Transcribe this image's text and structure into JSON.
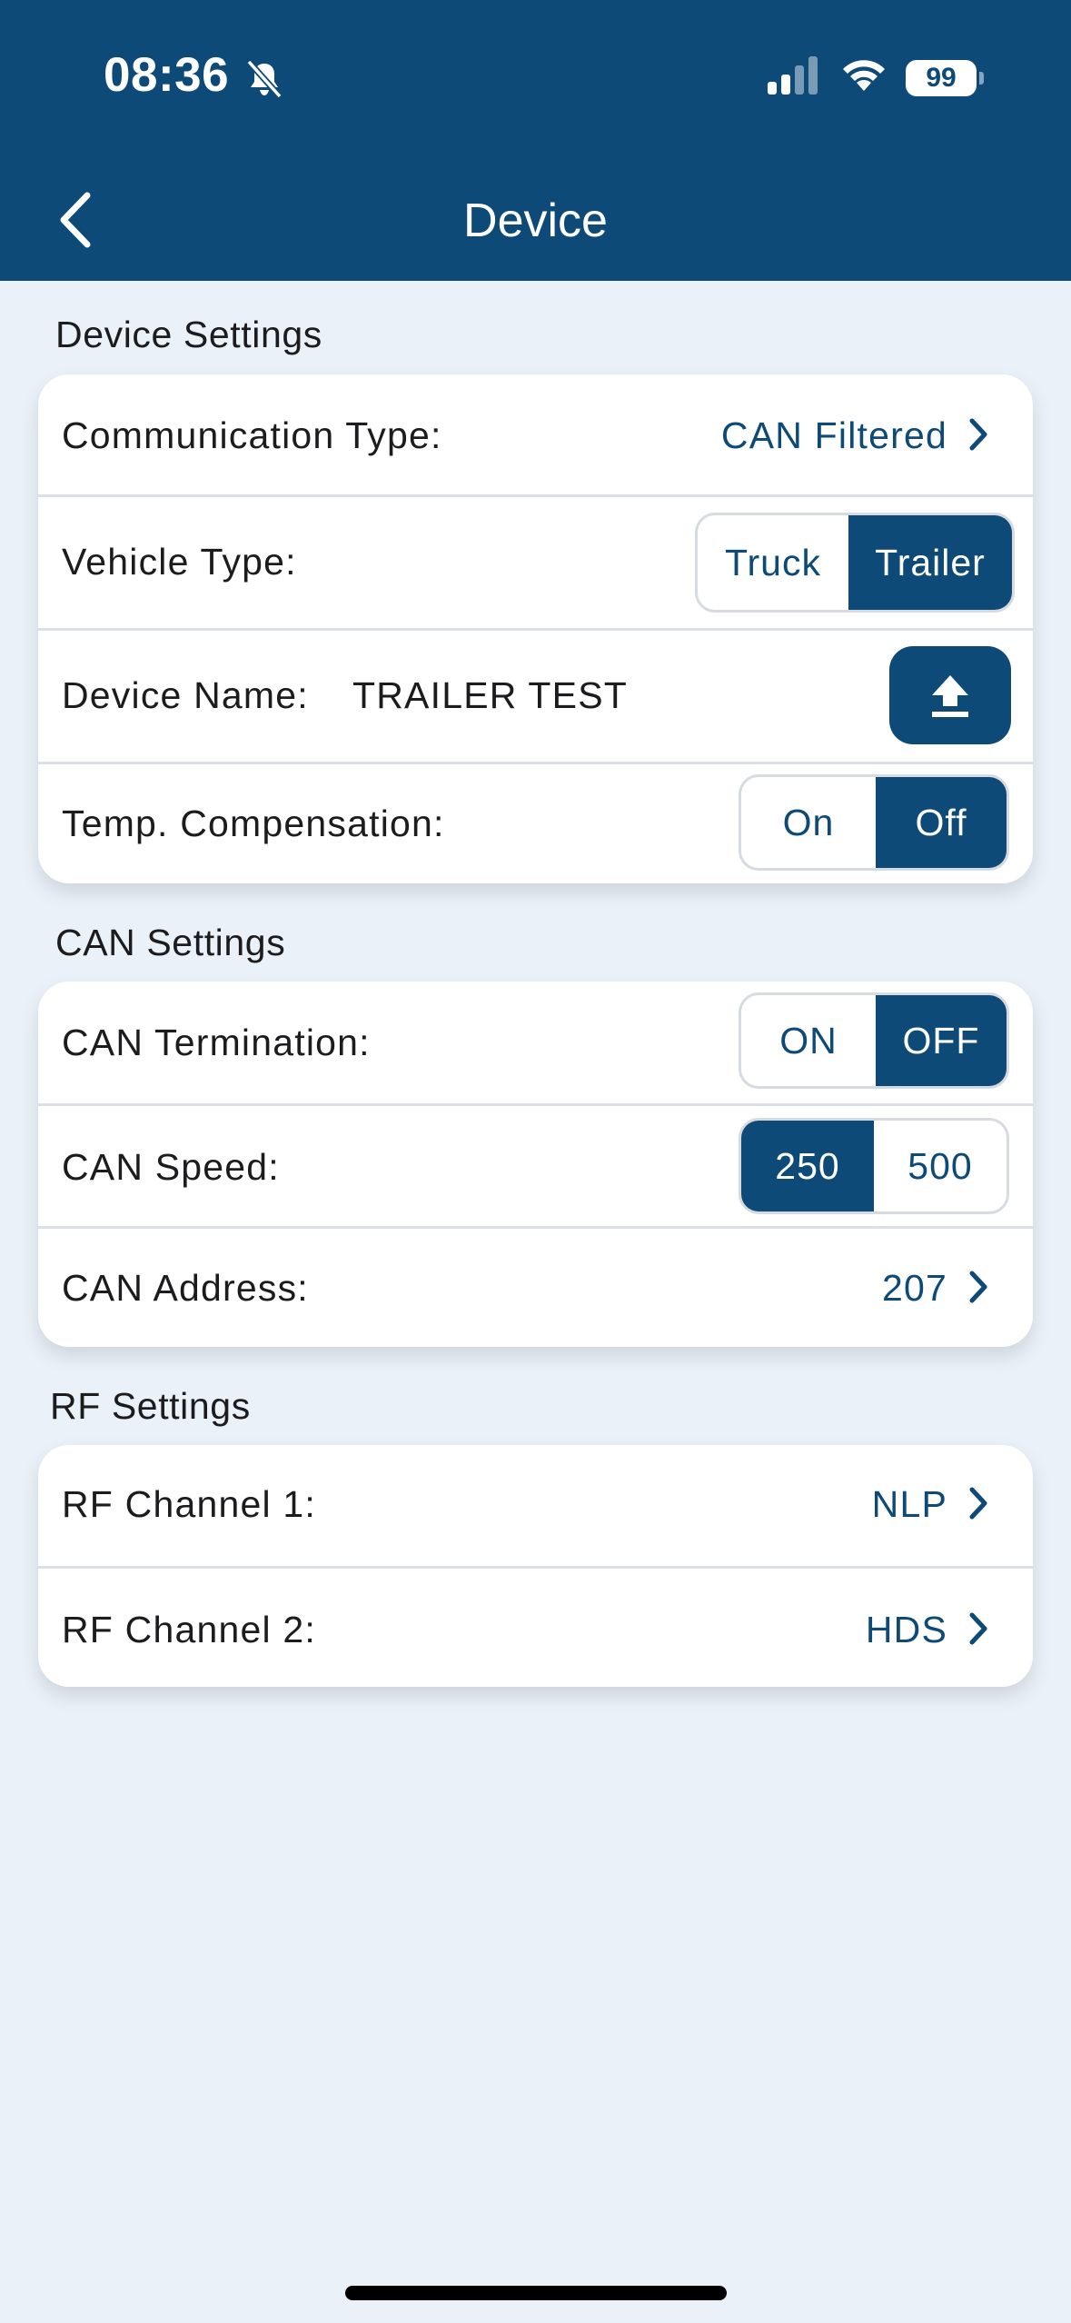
{
  "status_bar": {
    "time": "08:36",
    "battery": "99"
  },
  "nav": {
    "title": "Device"
  },
  "device_settings": {
    "heading": "Device Settings",
    "communication_type": {
      "label": "Communication Type:",
      "value": "CAN Filtered"
    },
    "vehicle_type": {
      "label": "Vehicle Type:",
      "options": [
        "Truck",
        "Trailer"
      ],
      "selected": "Trailer"
    },
    "device_name": {
      "label": "Device Name:",
      "value": "TRAILER TEST"
    },
    "temp_compensation": {
      "label": "Temp. Compensation:",
      "options": [
        "On",
        "Off"
      ],
      "selected": "Off"
    }
  },
  "can_settings": {
    "heading": "CAN Settings",
    "termination": {
      "label": "CAN Termination:",
      "options": [
        "ON",
        "OFF"
      ],
      "selected": "OFF"
    },
    "speed": {
      "label": "CAN Speed:",
      "options": [
        "250",
        "500"
      ],
      "selected": "250"
    },
    "address": {
      "label": "CAN Address:",
      "value": "207"
    }
  },
  "rf_settings": {
    "heading": "RF Settings",
    "channel1": {
      "label": "RF Channel 1:",
      "value": "NLP"
    },
    "channel2": {
      "label": "RF Channel 2:",
      "value": "HDS"
    }
  },
  "colors": {
    "primary": "#0e4a78",
    "background": "#eaf1f9"
  },
  "icons": [
    "bell-slash-icon",
    "signal-icon",
    "wifi-icon",
    "battery-icon",
    "back-chevron-icon",
    "chevron-right-icon",
    "upload-icon"
  ]
}
